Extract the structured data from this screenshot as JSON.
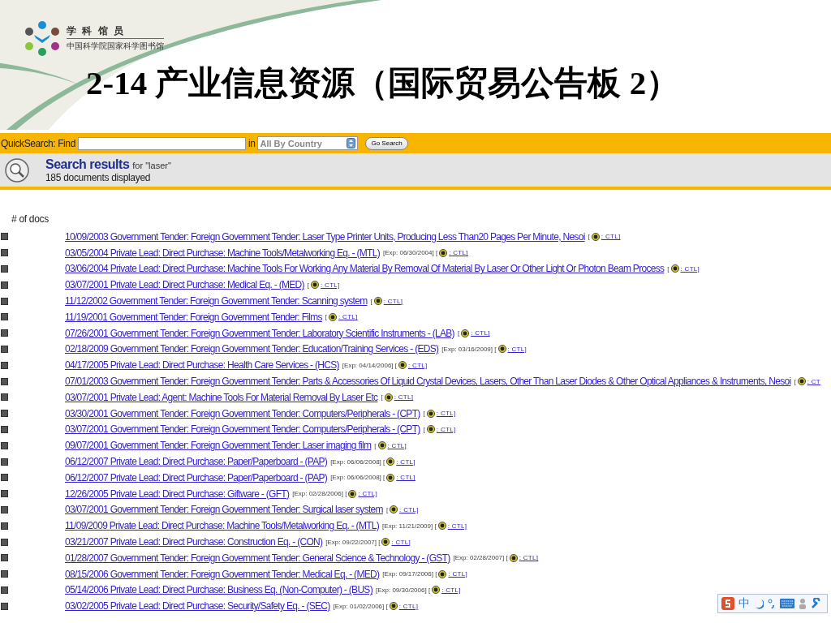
{
  "logo": {
    "name": "学 科 馆 员",
    "subtitle": "中国科学院国家科学图书馆"
  },
  "title": "2-14 产业信息资源（国际贸易公告板 2）",
  "search": {
    "label": "QuickSearch: Find",
    "in_label": "in",
    "scope": "All By Country",
    "button": "Go Search"
  },
  "results": {
    "heading": "Search results",
    "query": "for \"laser\"",
    "count": "185 documents displayed"
  },
  "list_header": "# of docs",
  "rows": [
    {
      "link": "10/09/2003 Government Tender: Foreign Government Tender: Laser Type Printer Units, Producing Less Than20 Pages Per Minute, Nesoi",
      "note": "[",
      "ctl": ": CTL]"
    },
    {
      "link": "03/05/2004 Private Lead: Direct Purchase: Machine Tools/Metalworking Eq. - (MTL)",
      "note": "[Exp: 06/30/2004] [",
      "ctl": ": CTL]"
    },
    {
      "link": "03/06/2004 Private Lead: Direct Purchase: Machine Tools For Working Any Material By Removal Of Material By Laser Or Other Light Or Photon Beam Process",
      "note": "[",
      "ctl": ": CTL]"
    },
    {
      "link": "03/07/2001 Private Lead: Direct Purchase: Medical Eq. - (MED)",
      "note": "[",
      "ctl": ": CTL]"
    },
    {
      "link": "11/12/2002 Government Tender: Foreign Government Tender: Scanning system",
      "note": "[",
      "ctl": ": CTL]"
    },
    {
      "link": "11/19/2001 Government Tender: Foreign Government Tender: Films",
      "note": "[",
      "ctl": ": CTL]"
    },
    {
      "link": "07/26/2001 Government Tender: Foreign Government Tender: Laboratory Scientific Instruments - (LAB)",
      "note": "[",
      "ctl": ": CTL]"
    },
    {
      "link": "02/18/2009 Government Tender: Foreign Government Tender: Education/Training Services - (EDS)",
      "note": "[Exp: 03/16/2009] [",
      "ctl": ": CTL]"
    },
    {
      "link": "04/17/2005 Private Lead: Direct Purchase: Health Care Services - (HCS)",
      "note": "[Exp: 04/14/2006] [",
      "ctl": ": CTL]"
    },
    {
      "link": "07/01/2003 Government Tender: Foreign Government Tender: Parts & Accessories Of Liquid Crystal Devices, Lasers, Other Than Laser Diodes & Other Optical Appliances & Instruments, Nesoi",
      "note": "[",
      "ctl": ": CT"
    },
    {
      "link": "03/07/2001 Private Lead: Agent: Machine Tools For Material Removal By Laser Etc",
      "note": "[",
      "ctl": ": CTL]"
    },
    {
      "link": "03/30/2001 Government Tender: Foreign Government Tender: Computers/Peripherals - (CPT)",
      "note": "[",
      "ctl": ": CTL]"
    },
    {
      "link": "03/07/2001 Government Tender: Foreign Government Tender: Computers/Peripherals - (CPT)",
      "note": "[",
      "ctl": ": CTL]"
    },
    {
      "link": "09/07/2001 Government Tender: Foreign Government Tender: Laser imaging film",
      "note": "[",
      "ctl": ": CTL]"
    },
    {
      "link": "06/12/2007 Private Lead: Direct Purchase: Paper/Paperboard - (PAP)",
      "note": "[Exp: 06/06/2008] [",
      "ctl": ": CTL]"
    },
    {
      "link": "06/12/2007 Private Lead: Direct Purchase: Paper/Paperboard - (PAP)",
      "note": "[Exp: 06/06/2008] [",
      "ctl": ": CTL]"
    },
    {
      "link": "12/26/2005 Private Lead: Direct Purchase: Giftware - (GFT)",
      "note": "[Exp: 02/28/2006] [",
      "ctl": ": CTL]"
    },
    {
      "link": "03/07/2001 Government Tender: Foreign Government Tender: Surgical laser system",
      "note": "[",
      "ctl": ": CTL]"
    },
    {
      "link": "11/09/2009 Private Lead: Direct Purchase: Machine Tools/Metalworking Eq. - (MTL)",
      "note": "[Exp: 11/21/2009] [",
      "ctl": ": CTL]"
    },
    {
      "link": "03/21/2007 Private Lead: Direct Purchase: Construction Eq. - (CON)",
      "note": "[Exp: 09/22/2007] [",
      "ctl": ": CTL]"
    },
    {
      "link": "01/28/2007 Government Tender: Foreign Government Tender: General Science & Technology - (GST)",
      "note": "[Exp: 02/28/2007] [",
      "ctl": ": CTL]"
    },
    {
      "link": "08/15/2006 Government Tender: Foreign Government Tender: Medical Eq. - (MED)",
      "note": "[Exp: 09/17/2006] [",
      "ctl": ": CTL]"
    },
    {
      "link": "05/14/2006 Private Lead: Direct Purchase: Business Eq. (Non-Computer) - (BUS)",
      "note": "[Exp: 09/30/2006] [",
      "ctl": ": CTL]"
    },
    {
      "link": "03/02/2005 Private Lead: Direct Purchase: Security/Safety Eq. - (SEC)",
      "note": "[Exp: 01/02/2006] [",
      "ctl": ": CTL]"
    }
  ],
  "ime_toolbar": {
    "mode": "中"
  }
}
